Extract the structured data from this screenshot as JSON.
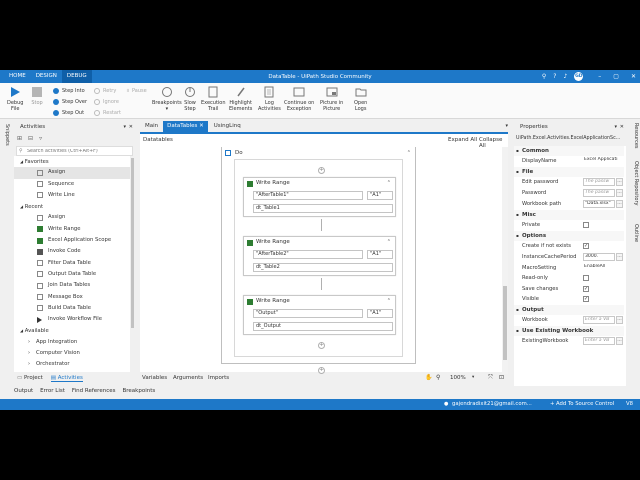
{
  "titlebar": {
    "tabs": [
      "HOME",
      "DESIGN",
      "DEBUG"
    ],
    "title": "DataTable - UiPath Studio Community",
    "user_initials": "GD"
  },
  "ribbon": {
    "debug_file": "Debug\nFile",
    "stop": "Stop",
    "step_into": "Step Into",
    "step_over": "Step Over",
    "step_out": "Step Out",
    "retry": "Retry",
    "ignore": "Ignore",
    "restart": "Restart",
    "pause": "Pause",
    "breakpoints": "Breakpoints",
    "slow_step": "Slow\nStep",
    "execution_trail": "Execution\nTrail",
    "highlight_elements": "Highlight\nElements",
    "log_activities": "Log\nActivities",
    "continue_on_exception": "Continue on\nException",
    "picture_in_picture": "Picture in\nPicture",
    "open_logs": "Open\nLogs"
  },
  "activities": {
    "header": "Activities",
    "search_placeholder": "Search activities (Ctrl+Alt+F)",
    "favorites_label": "Favorites",
    "favorites": [
      "Assign",
      "Sequence",
      "Write Line"
    ],
    "recent_label": "Recent",
    "recent": [
      "Assign",
      "Write Range",
      "Excel Application Scope",
      "Invoke Code",
      "Filter Data Table",
      "Output Data Table",
      "Join Data Tables",
      "Message Box",
      "Build Data Table",
      "Invoke Workflow File"
    ],
    "available_label": "Available",
    "available": [
      "App Integration",
      "Computer Vision",
      "Orchestrator"
    ],
    "bottom_tabs": [
      "Project",
      "Activities"
    ]
  },
  "snippets_label": "Snippets",
  "designer": {
    "tabs": [
      "Main",
      "DataTables",
      "UsingLinq"
    ],
    "breadcrumb": "Datatables",
    "expand_all": "Expand All",
    "collapse_all": "Collapse All",
    "do_label": "Do",
    "activities": [
      {
        "title": "Write Range",
        "sheet": "\"AfterTable1\"",
        "cell": "\"A1\"",
        "table": "dt_Table1"
      },
      {
        "title": "Write Range",
        "sheet": "\"AfterTable2\"",
        "cell": "\"A1\"",
        "table": "dt_Table2"
      },
      {
        "title": "Write Range",
        "sheet": "\"Output\"",
        "cell": "\"A1\"",
        "table": "dt_Output"
      }
    ],
    "bottom_tabs": [
      "Variables",
      "Arguments",
      "Imports"
    ],
    "zoom": "100%"
  },
  "properties": {
    "header": "Properties",
    "type": "UiPath.Excel.Activities.ExcelApplicationSc...",
    "sections": {
      "common": "Common",
      "file": "File",
      "misc": "Misc",
      "options": "Options",
      "output": "Output",
      "use_existing": "Use Existing Workbook"
    },
    "display_name_label": "DisplayName",
    "display_name_value": "Excel Applicati",
    "edit_password_label": "Edit password",
    "edit_password_ph": "The passw",
    "password_label": "Password",
    "password_ph": "The passw",
    "workbook_path_label": "Workbook path",
    "workbook_path_value": "\"Data.xlsx\"",
    "private_label": "Private",
    "create_label": "Create if not exists",
    "instance_label": "InstanceCachePeriod",
    "instance_value": "3000.",
    "macro_label": "MacroSetting",
    "macro_value": "EnableAll",
    "readonly_label": "Read-only",
    "save_label": "Save changes",
    "visible_label": "Visible",
    "workbook_label": "Workbook",
    "workbook_ph": "Enter a VB",
    "existing_label": "ExistingWorkbook",
    "existing_ph": "Enter a VB"
  },
  "right_rail": [
    "Resources",
    "Object Repository",
    "Outline"
  ],
  "output_tabs": [
    "Output",
    "Error List",
    "Find References",
    "Breakpoints"
  ],
  "status": {
    "user": "gajendradixit21@gmail.com...",
    "source_control": "Add To Source Control",
    "version": "V8"
  }
}
